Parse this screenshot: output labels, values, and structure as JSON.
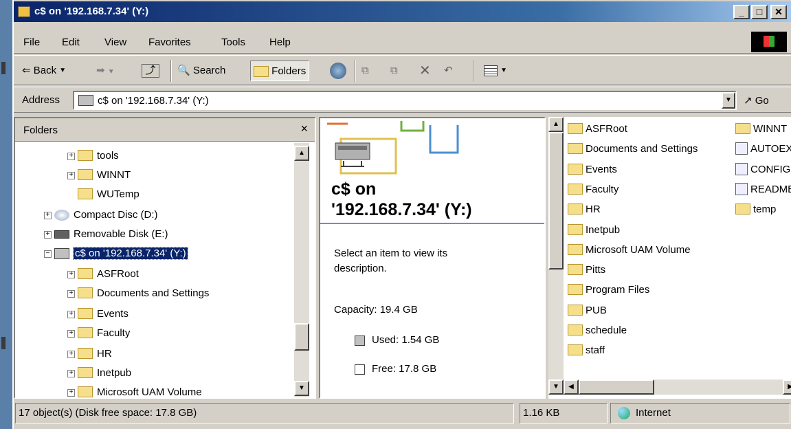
{
  "window": {
    "title": "c$ on '192.168.7.34' (Y:)"
  },
  "menu": [
    "File",
    "Edit",
    "View",
    "Favorites",
    "Tools",
    "Help"
  ],
  "toolbar": {
    "back": "Back",
    "search": "Search",
    "folders": "Folders"
  },
  "address": {
    "label": "Address",
    "value": "c$ on '192.168.7.34' (Y:)",
    "go": "Go"
  },
  "folders_pane": {
    "title": "Folders",
    "close": "×",
    "tree": [
      "tools",
      "WINNT",
      "WUTemp",
      "Compact Disc (D:)",
      "Removable Disk (E:)",
      "c$ on '192.168.7.34' (Y:)",
      "ASFRoot",
      "Documents and Settings",
      "Events",
      "Faculty",
      "HR",
      "Inetpub",
      "Microsoft UAM Volume"
    ]
  },
  "info": {
    "title_line1": "c$ on",
    "title_line2": "'192.168.7.34' (Y:)",
    "description": "Select an item to view its description.",
    "capacity": "Capacity: 19.4 GB",
    "used": "Used: 1.54 GB",
    "free": "Free: 17.8 GB"
  },
  "files": {
    "col1": [
      "ASFRoot",
      "Documents and Settings",
      "Events",
      "Faculty",
      "HR",
      "Inetpub",
      "Microsoft UAM Volume",
      "Pitts",
      "Program Files",
      "PUB",
      "schedule",
      "staff"
    ],
    "col2": [
      "WINNT",
      "AUTOEX",
      "CONFIG",
      "README",
      "temp"
    ]
  },
  "status": {
    "objects": "17 object(s) (Disk free space: 17.8 GB)",
    "size": "1.16 KB",
    "zone": "Internet"
  }
}
